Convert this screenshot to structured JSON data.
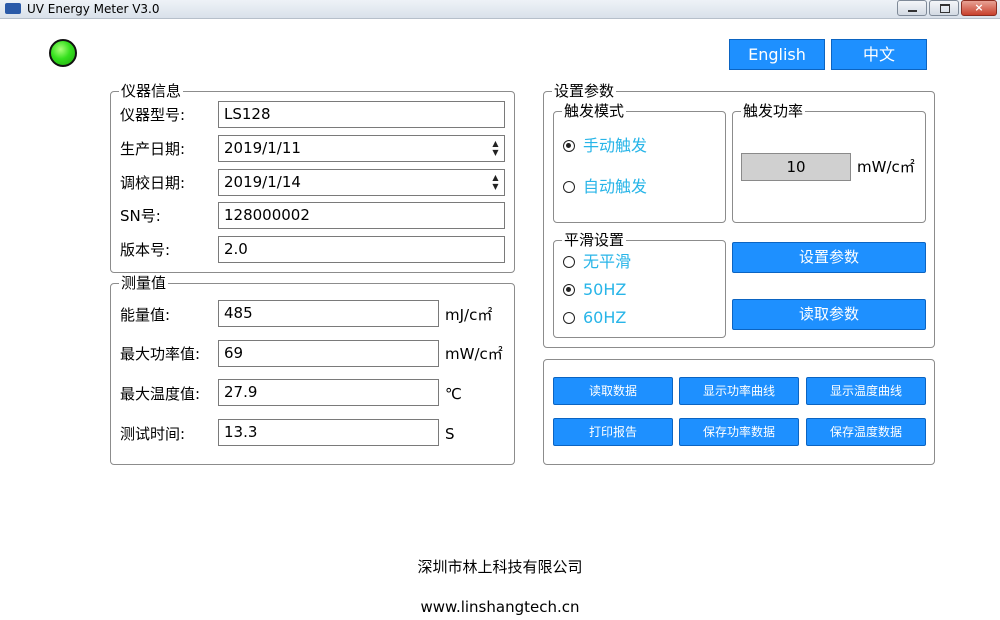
{
  "window": {
    "title": "UV Energy Meter V3.0",
    "buttons": {
      "minimize": "",
      "maximize": "",
      "close": "×"
    }
  },
  "language": {
    "english": "English",
    "chinese": "中文"
  },
  "device_info": {
    "legend": "仪器信息",
    "model_label": "仪器型号:",
    "model_value": "LS128",
    "production_date_label": "生产日期:",
    "production_date_value": "2019/1/11",
    "calibration_date_label": "调校日期:",
    "calibration_date_value": "2019/1/14",
    "sn_label": "SN号:",
    "sn_value": "128000002",
    "version_label": "版本号:",
    "version_value": "2.0"
  },
  "measurement": {
    "legend": "测量值",
    "energy_label": "能量值:",
    "energy_value": "485",
    "energy_unit": "mJ/c㎡",
    "max_power_label": "最大功率值:",
    "max_power_value": "69",
    "max_power_unit": "mW/c㎡",
    "max_temp_label": "最大温度值:",
    "max_temp_value": "27.9",
    "max_temp_unit": "℃",
    "test_time_label": "测试时间:",
    "test_time_value": "13.3",
    "test_time_unit": "S"
  },
  "settings": {
    "legend": "设置参数",
    "trigger_mode": {
      "legend": "触发模式",
      "manual": "手动触发",
      "auto": "自动触发",
      "selected": "manual"
    },
    "trigger_power": {
      "legend": "触发功率",
      "value": "10",
      "unit": "mW/c㎡"
    },
    "smoothing": {
      "legend": "平滑设置",
      "none": "无平滑",
      "hz50": "50HZ",
      "hz60": "60HZ",
      "selected": "50HZ"
    },
    "set_button": "设置参数",
    "read_button": "读取参数"
  },
  "actions": {
    "read_data": "读取数据",
    "show_power_curve": "显示功率曲线",
    "show_temp_curve": "显示温度曲线",
    "print_report": "打印报告",
    "save_power_data": "保存功率数据",
    "save_temp_data": "保存温度数据"
  },
  "footer": {
    "company": "深圳市林上科技有限公司",
    "website": "www.linshangtech.cn"
  },
  "colors": {
    "accent_button": "#1e90ff",
    "radio_label": "#28b5e8",
    "led": "#35e01e"
  }
}
